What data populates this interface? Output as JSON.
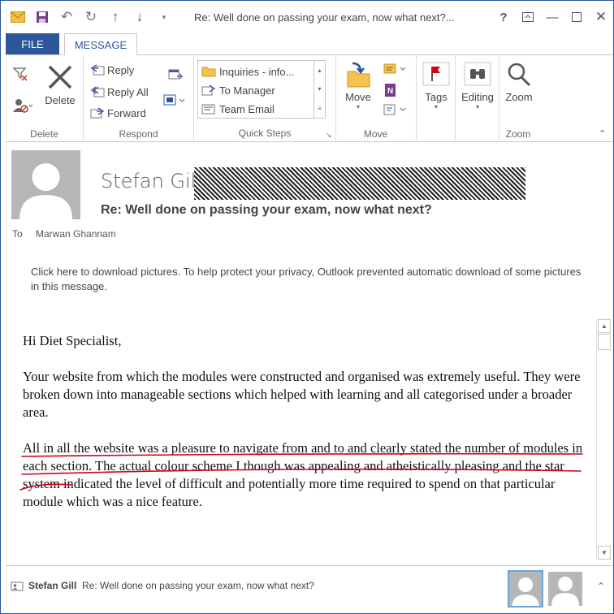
{
  "window": {
    "title": "Re: Well done on passing your exam, now what next?...",
    "help": "?",
    "colors": {
      "accent": "#2b579a",
      "ink": "#d0021b"
    }
  },
  "tabs": {
    "file": "FILE",
    "message": "MESSAGE"
  },
  "ribbon": {
    "delete_group": {
      "label": "Delete",
      "delete_button": "Delete"
    },
    "respond_group": {
      "label": "Respond",
      "reply": "Reply",
      "reply_all": "Reply All",
      "forward": "Forward"
    },
    "quick_steps": {
      "label": "Quick Steps",
      "items": [
        "Inquiries - info...",
        "To Manager",
        "Team Email"
      ]
    },
    "move_group": {
      "label": "Move",
      "move_button": "Move"
    },
    "tags": {
      "label": "Tags"
    },
    "editing": {
      "label": "Editing"
    },
    "zoom_group": {
      "label": "Zoom",
      "zoom_button": "Zoom"
    }
  },
  "message": {
    "sender": "Stefan Gill",
    "subject": "Re: Well done on passing your exam, now what next?",
    "to_label": "To",
    "to": "Marwan Ghannam",
    "info_bar": "Click here to download pictures. To help protect your privacy, Outlook prevented automatic download of some pictures in this message.",
    "body": {
      "greeting": "Hi Diet Specialist,",
      "para1": "Your website from which the modules were constructed and organised was extremely useful. They were broken down into manageable sections which helped with learning and all categorised under a broader area.",
      "para2": "All in all the website was a pleasure to navigate from and to and clearly stated the number of modules in each section. The actual colour scheme I though was appealing and atheistically pleasing and the star system indicated the level of difficult and potentially more time required to spend on that particular module which was a nice feature."
    }
  },
  "footer": {
    "sender": "Stefan Gill",
    "subject": "Re: Well done on passing your exam, now what next?"
  }
}
